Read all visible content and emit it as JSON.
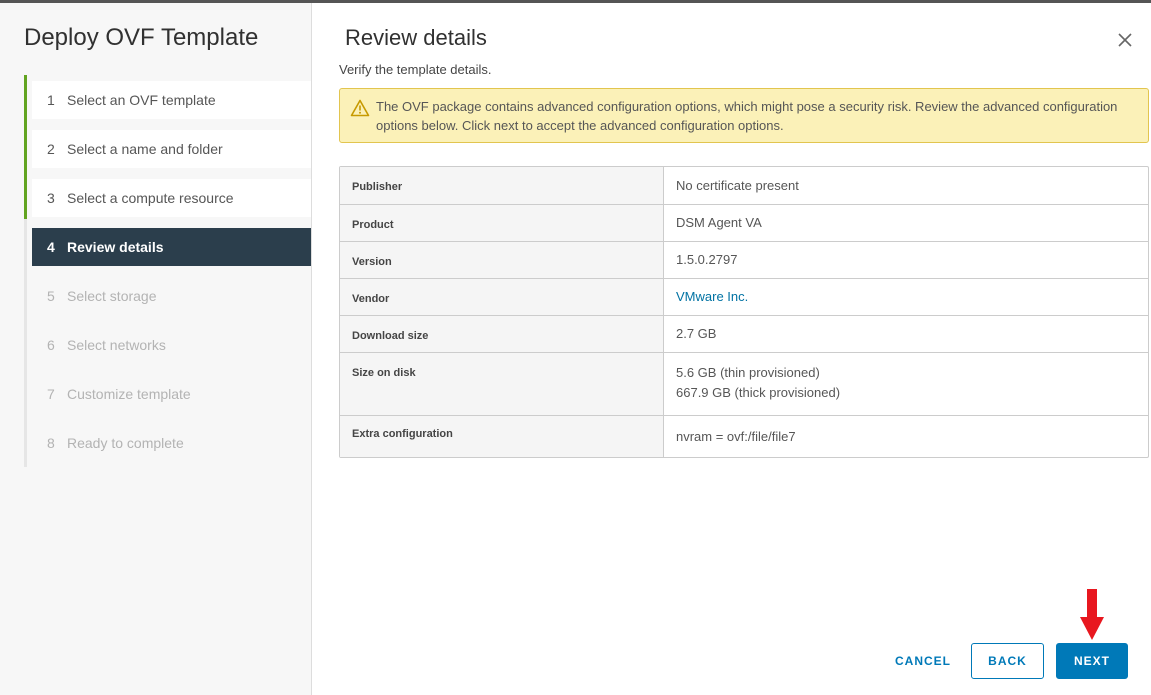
{
  "wizard": {
    "title": "Deploy OVF Template",
    "steps": [
      {
        "num": "1",
        "label": "Select an OVF template",
        "state": "done"
      },
      {
        "num": "2",
        "label": "Select a name and folder",
        "state": "done"
      },
      {
        "num": "3",
        "label": "Select a compute resource",
        "state": "done"
      },
      {
        "num": "4",
        "label": "Review details",
        "state": "current"
      },
      {
        "num": "5",
        "label": "Select storage",
        "state": "future"
      },
      {
        "num": "6",
        "label": "Select networks",
        "state": "future"
      },
      {
        "num": "7",
        "label": "Customize template",
        "state": "future"
      },
      {
        "num": "8",
        "label": "Ready to complete",
        "state": "future"
      }
    ]
  },
  "page": {
    "title": "Review details",
    "subtitle": "Verify the template details.",
    "close_icon": "close-icon"
  },
  "alert": {
    "icon": "warning-icon",
    "text": "The OVF package contains advanced configuration options, which might pose a security risk. Review the advanced configuration options below. Click next to accept the advanced configuration options."
  },
  "details": {
    "rows": [
      {
        "label": "Publisher",
        "values": [
          "No certificate present"
        ]
      },
      {
        "label": "Product",
        "values": [
          "DSM Agent VA"
        ]
      },
      {
        "label": "Version",
        "values": [
          "1.5.0.2797"
        ]
      },
      {
        "label": "Vendor",
        "values": [
          "VMware Inc."
        ]
      },
      {
        "label": "Download size",
        "values": [
          "2.7 GB"
        ]
      },
      {
        "label": "Size on disk",
        "values": [
          "5.6 GB (thin provisioned)",
          "667.9 GB (thick provisioned)"
        ]
      },
      {
        "label": "Extra configuration",
        "values": [
          "nvram = ovf:/file/file7"
        ]
      }
    ]
  },
  "footer": {
    "cancel_label": "CANCEL",
    "back_label": "BACK",
    "next_label": "NEXT"
  },
  "colors": {
    "accent": "#0079b8",
    "progress": "#62a420",
    "current_step_bg": "#2b3e4c",
    "alert_bg": "#fbf1b8",
    "annotation_arrow": "#e8171f"
  }
}
